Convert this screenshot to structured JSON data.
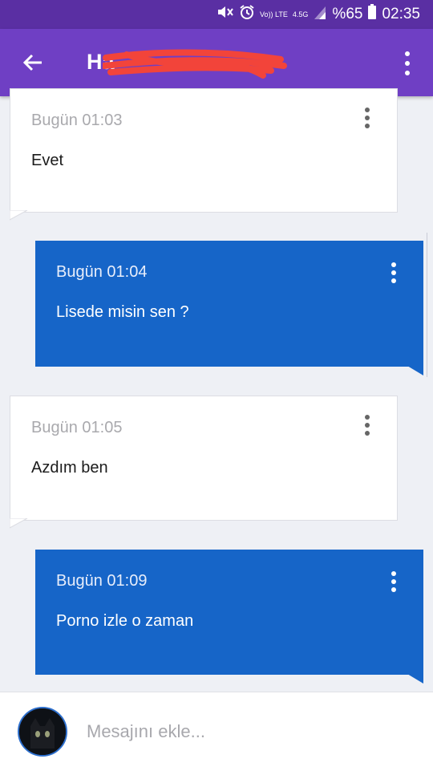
{
  "status_bar": {
    "volte": "Vo)) LTE",
    "network": "4.5G",
    "battery": "%65",
    "time": "02:35"
  },
  "header": {
    "title": "Ha",
    "back_icon": "arrow-left-icon",
    "menu_icon": "more-vert-icon"
  },
  "messages": [
    {
      "direction": "incoming",
      "time": "Bugün 01:03",
      "text": "Evet"
    },
    {
      "direction": "outgoing",
      "time": "Bugün 01:04",
      "text": "Lisede misin sen ?"
    },
    {
      "direction": "incoming",
      "time": "Bugün 01:05",
      "text": "Azdım ben"
    },
    {
      "direction": "outgoing",
      "time": "Bugün 01:09",
      "text": "Porno izle o zaman"
    }
  ],
  "composer": {
    "placeholder": "Mesajını ekle..."
  },
  "colors": {
    "status_bar": "#5a2fa3",
    "app_bar": "#6f3fc4",
    "outgoing_bubble": "#1665c8",
    "incoming_bubble": "#ffffff",
    "background": "#eef0f5"
  }
}
